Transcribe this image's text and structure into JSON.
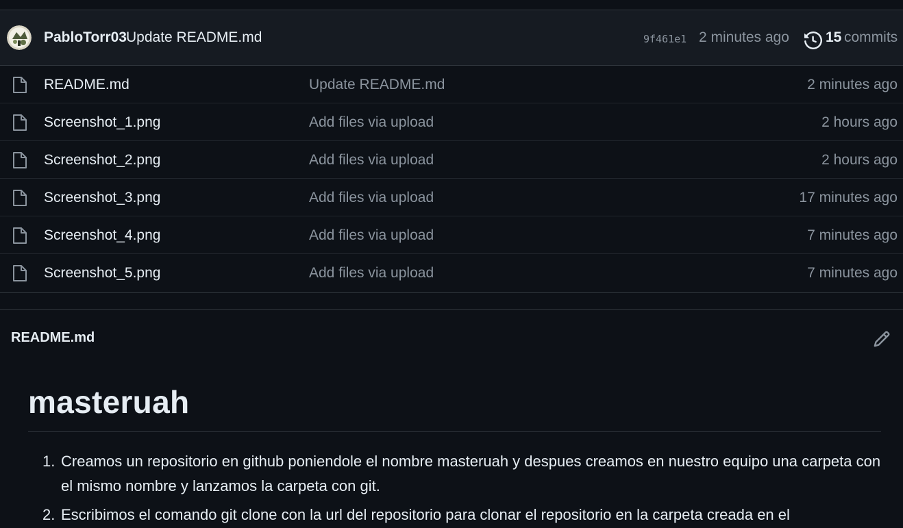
{
  "commit": {
    "author": "PabloTorr03",
    "message": "Update README.md",
    "sha": "9f461e1",
    "time": "2 minutes ago",
    "commit_count": "15",
    "commits_label": "commits"
  },
  "files": [
    {
      "name": "README.md",
      "message": "Update README.md",
      "time": "2 minutes ago"
    },
    {
      "name": "Screenshot_1.png",
      "message": "Add files via upload",
      "time": "2 hours ago"
    },
    {
      "name": "Screenshot_2.png",
      "message": "Add files via upload",
      "time": "2 hours ago"
    },
    {
      "name": "Screenshot_3.png",
      "message": "Add files via upload",
      "time": "17 minutes ago"
    },
    {
      "name": "Screenshot_4.png",
      "message": "Add files via upload",
      "time": "7 minutes ago"
    },
    {
      "name": "Screenshot_5.png",
      "message": "Add files via upload",
      "time": "7 minutes ago"
    }
  ],
  "readme": {
    "filename": "README.md",
    "heading": "masteruah",
    "items": [
      {
        "num": "1.",
        "text": "Creamos un repositorio en github poniendole el nombre masteruah y despues creamos en nuestro equipo una carpeta con el mismo nombre y lanzamos la carpeta con git."
      },
      {
        "num": "2.",
        "text": "Escribimos el comando git clone con la url del repositorio para clonar el repositorio en la carpeta creada en el"
      }
    ]
  },
  "icons": {
    "file": "file-icon",
    "history": "history-icon",
    "edit": "pencil-icon",
    "avatar": "avatar"
  },
  "colors": {
    "background": "#0d1117",
    "header_bg": "#161b22",
    "border": "#30363d",
    "text": "#e6edf3",
    "muted": "#8b949e"
  }
}
